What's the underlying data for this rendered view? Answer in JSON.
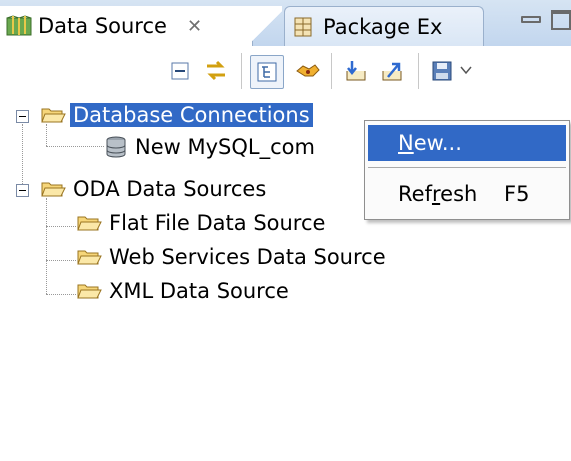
{
  "tabs": [
    {
      "label": "Data Source",
      "close": "✕",
      "active": true
    },
    {
      "label": "Package Ex",
      "active": false
    }
  ],
  "tree": {
    "database_connections": "Database Connections",
    "mysql_connection": "New MySQL_com",
    "oda_sources": "ODA Data Sources",
    "flat_file": "Flat File Data Source",
    "web_services": "Web Services Data Source",
    "xml": "XML Data Source"
  },
  "context_menu": {
    "new": {
      "pre": "",
      "mnemonic": "N",
      "post": "ew..."
    },
    "refresh": {
      "pre": "Ref",
      "mnemonic": "r",
      "post": "esh",
      "accelerator": "F5"
    }
  },
  "colors": {
    "selection": "#3169c6",
    "tab_bar": "#c2d6ee"
  }
}
